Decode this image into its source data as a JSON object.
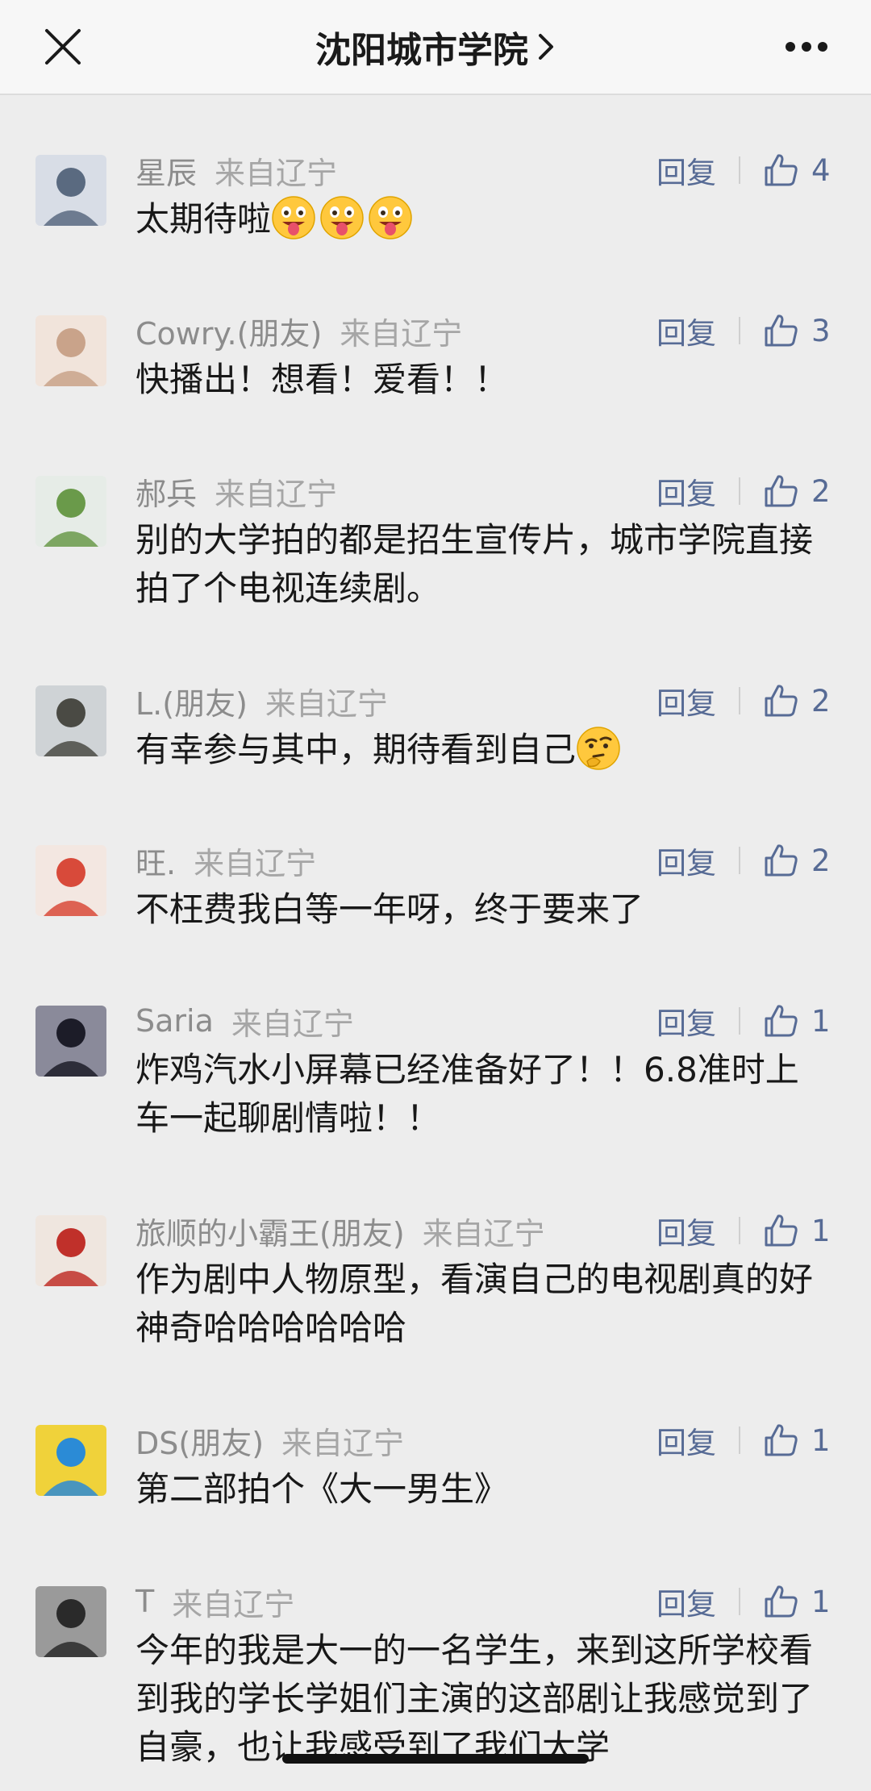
{
  "header": {
    "title": "沈阳城市学院"
  },
  "comments": [
    {
      "name": "星辰",
      "location": "来自辽宁",
      "reply": "回复",
      "likes": "4",
      "text": "太期待啦",
      "emoji_count": 3,
      "emoji": "tongue-out-emoji",
      "avatar_colors": [
        "#5a6a80",
        "#d8dde6"
      ]
    },
    {
      "name": "Cowry.(朋友)",
      "location": "来自辽宁",
      "reply": "回复",
      "likes": "3",
      "text": "快播出！想看！爱看！！",
      "avatar_colors": [
        "#c9a38a",
        "#f1e4db"
      ]
    },
    {
      "name": "郝兵",
      "location": "来自辽宁",
      "reply": "回复",
      "likes": "2",
      "text": "别的大学拍的都是招生宣传片，城市学院直接拍了个电视连续剧。",
      "avatar_colors": [
        "#6a9a4a",
        "#e6ece7"
      ]
    },
    {
      "name": "L.(朋友)",
      "location": "来自辽宁",
      "reply": "回复",
      "likes": "2",
      "text": "有幸参与其中，期待看到自己",
      "emoji_after": 1,
      "emoji": "thinking-emoji",
      "avatar_colors": [
        "#4a4a44",
        "#cfd3d6"
      ]
    },
    {
      "name": "旺.",
      "location": "来自辽宁",
      "reply": "回复",
      "likes": "2",
      "text": "不枉费我白等一年呀，终于要来了",
      "avatar_colors": [
        "#d84a3a",
        "#f3e7e1"
      ]
    },
    {
      "name": "Saria",
      "location": "来自辽宁",
      "reply": "回复",
      "likes": "1",
      "text": "炸鸡汽水小屏幕已经准备好了！！6.8准时上车一起聊剧情啦！！",
      "avatar_colors": [
        "#1c1c28",
        "#8a8a9a"
      ]
    },
    {
      "name": "旅顺的小霸王(朋友)",
      "location": "来自辽宁",
      "reply": "回复",
      "likes": "1",
      "text": "作为剧中人物原型，看演自己的电视剧真的好神奇哈哈哈哈哈哈",
      "avatar_colors": [
        "#c0302a",
        "#efe6df"
      ]
    },
    {
      "name": "DS(朋友)",
      "location": "来自辽宁",
      "reply": "回复",
      "likes": "1",
      "text": "第二部拍个《大一男生》",
      "avatar_colors": [
        "#2b8bd6",
        "#f0d23a"
      ]
    },
    {
      "name": "T",
      "location": "来自辽宁",
      "reply": "回复",
      "likes": "1",
      "text": "今年的我是大一的一名学生，来到这所学校看到我的学长学姐们主演的这部剧让我感觉到了自豪，也让我感受到了我们大学",
      "avatar_colors": [
        "#2a2a2a",
        "#9a9a9a"
      ]
    }
  ],
  "colors": {
    "accent": "#576b95",
    "background": "#ededed",
    "header": "#f7f7f7"
  }
}
